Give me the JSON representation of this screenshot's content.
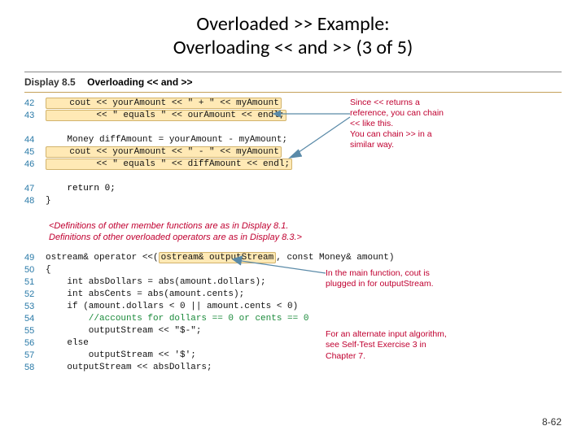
{
  "slide": {
    "title_line1": "Overloaded >> Example:",
    "title_line2": "Overloading << and >> (3 of 5)",
    "page_number": "8-62"
  },
  "display": {
    "label": "Display 8.5",
    "title": "Overloading << and >>"
  },
  "code": {
    "lines": [
      {
        "n": "42",
        "text": "    cout << yourAmount << \" + \" << myAmount"
      },
      {
        "n": "43",
        "text": "         << \" equals \" << ourAmount << endl;"
      },
      {
        "n": "",
        "text": ""
      },
      {
        "n": "44",
        "text": "    Money diffAmount = yourAmount - myAmount;"
      },
      {
        "n": "45",
        "text": "    cout << yourAmount << \" - \" << myAmount"
      },
      {
        "n": "46",
        "text": "         << \" equals \" << diffAmount << endl;"
      },
      {
        "n": "",
        "text": ""
      },
      {
        "n": "47",
        "text": "    return 0;"
      },
      {
        "n": "48",
        "text": "}"
      }
    ],
    "mid_note": "<Definitions of other member functions are as in Display 8.1.\nDefinitions of other overloaded operators are as in Display 8.3.>",
    "lines2": [
      {
        "n": "49",
        "prefix": "ostream& operator <<(",
        "hl": "ostream& outputStream",
        "suffix": ", const Money& amount)"
      },
      {
        "n": "50",
        "text": "{"
      },
      {
        "n": "51",
        "text": "    int absDollars = abs(amount.dollars);"
      },
      {
        "n": "52",
        "text": "    int absCents = abs(amount.cents);"
      },
      {
        "n": "53",
        "text": "    if (amount.dollars < 0 || amount.cents < 0)"
      },
      {
        "n": "54",
        "text": "        //accounts for dollars == 0 or cents == 0"
      },
      {
        "n": "55",
        "text": "        outputStream << \"$-\";"
      },
      {
        "n": "56",
        "text": "    else"
      },
      {
        "n": "57",
        "text": "        outputStream << '$';"
      },
      {
        "n": "58",
        "text": "    outputStream << absDollars;"
      }
    ]
  },
  "notes": {
    "chain": "Since << returns a\nreference, you can chain\n<< like this.\nYou can chain >> in a\nsimilar way.",
    "main_cout": "In the main function, cout is\nplugged in for outputStream.",
    "alt_input": "For an alternate input algorithm,\nsee Self-Test Exercise 3 in\nChapter 7."
  }
}
